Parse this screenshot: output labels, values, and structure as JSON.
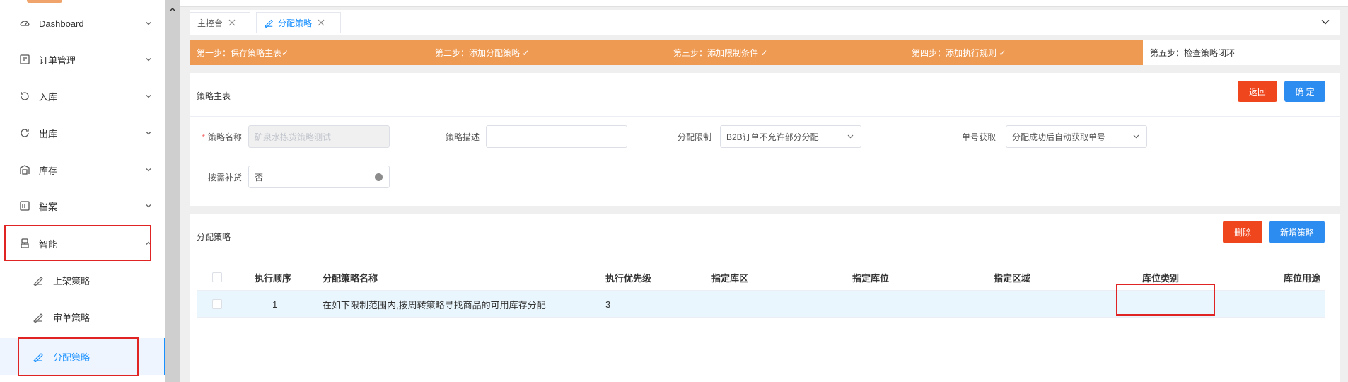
{
  "colors": {
    "accent": "#1890ff",
    "steps_bg": "#ef9a52",
    "danger": "#f0461e",
    "primary": "#2d8cf0",
    "highlight": "#e02424"
  },
  "sidebar": {
    "menu": [
      {
        "label": "Dashboard",
        "icon": "dashboard-icon"
      },
      {
        "label": "订单管理",
        "icon": "order-icon"
      },
      {
        "label": "入库",
        "icon": "inbound-icon"
      },
      {
        "label": "出库",
        "icon": "outbound-icon"
      },
      {
        "label": "库存",
        "icon": "inventory-icon"
      },
      {
        "label": "档案",
        "icon": "archive-icon"
      },
      {
        "label": "智能",
        "icon": "smart-icon"
      }
    ],
    "submenu": [
      {
        "label": "上架策略",
        "icon": "strategy-icon"
      },
      {
        "label": "审单策略",
        "icon": "strategy-icon"
      },
      {
        "label": "分配策略",
        "icon": "strategy-icon",
        "active": true
      }
    ]
  },
  "tabs": [
    {
      "label": "主控台"
    },
    {
      "label": "分配策略",
      "active": true
    }
  ],
  "steps": [
    "第一步：保存策略主表✓",
    "第二步：添加分配策略 ✓",
    "第三步：添加限制条件 ✓",
    "第四步：添加执行规则 ✓",
    "第五步：检查策略闭环"
  ],
  "master": {
    "title": "策略主表",
    "back_label": "返回",
    "confirm_label": "确 定",
    "fields": {
      "name_label": "策略名称",
      "name_value": "矿泉水拣货策略测试",
      "desc_label": "策略描述",
      "desc_value": "",
      "alloc_limit_label": "分配限制",
      "alloc_limit_value": "B2B订单不允许部分分配",
      "order_no_label": "单号获取",
      "order_no_value": "分配成功后自动获取单号",
      "replenish_label": "按需补货",
      "replenish_value": "否"
    }
  },
  "alloc": {
    "title": "分配策略",
    "delete_label": "删除",
    "add_label": "新增策略",
    "columns": [
      "执行顺序",
      "分配策略名称",
      "执行优先级",
      "指定库区",
      "指定库位",
      "指定区域",
      "库位类别",
      "库位用途"
    ],
    "rows": [
      [
        "1",
        "在如下限制范围内,按周转策略寻找商品的可用库存分配",
        "3",
        "",
        "",
        "",
        "",
        ""
      ]
    ]
  }
}
